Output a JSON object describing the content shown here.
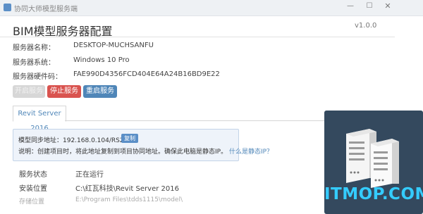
{
  "window": {
    "title": "协同大师模型服务端",
    "minimize": "—",
    "maximize": "☐",
    "close": "✕"
  },
  "header": {
    "title": "BIM模型服务器配置",
    "version": "v1.0.0"
  },
  "server_info": {
    "name_label": "服务器名称：",
    "name_value": "DESKTOP-MUCHSANFU",
    "os_label": "服务器系统：",
    "os_value": "Windows 10 Pro",
    "hwid_label": "服务器硬件码：",
    "hwid_value": "FAE990D4356FCD404E64A24B16BD9E22"
  },
  "buttons": {
    "start": "开启服务",
    "stop": "停止服务",
    "restart": "重启服务"
  },
  "tabs": [
    {
      "label": "Revit Server 2016",
      "active": true
    }
  ],
  "notice": {
    "address": "模型同步地址：192.168.0.104/RS2016",
    "copy_label": "复制",
    "desc": "说明：创建项目时，将此地址复制到项目协同地址。确保此电脑是静态IP。",
    "link": "什么是静态IP？"
  },
  "status": {
    "service_label": "服务状态",
    "service_value": "正在运行",
    "install_label": "安装位置",
    "install_value": "C:\\红瓦科技\\Revit Server 2016",
    "storage_label": "存储位置",
    "storage_value": "E:\\Program Files\\tdds1115\\model\\"
  },
  "watermark": {
    "text": "ITMOP.COM"
  },
  "colors": {
    "accent": "#4f86b8",
    "danger": "#d9534f",
    "disabled": "#d7d7d7",
    "logo_bg": "#34495e",
    "logo_text": "#34ccff"
  }
}
